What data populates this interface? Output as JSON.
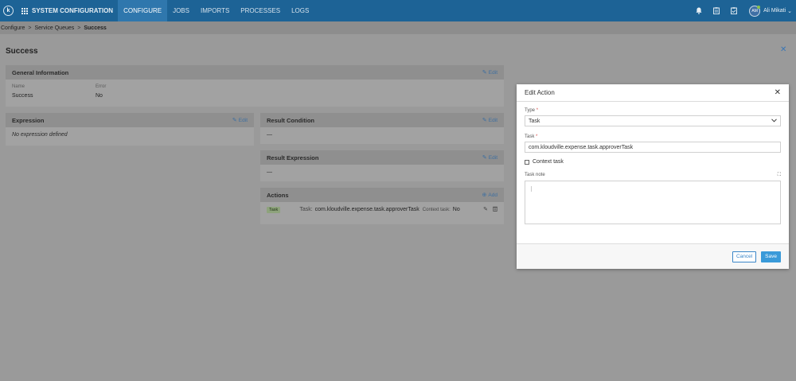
{
  "nav": {
    "logo": "k",
    "brand": "SYSTEM CONFIGURATION",
    "items": [
      "CONFIGURE",
      "JOBS",
      "IMPORTS",
      "PROCESSES",
      "LOGS"
    ],
    "active": "CONFIGURE",
    "icons": [
      "bell-icon",
      "clipboard-icon",
      "checklist-icon"
    ],
    "user": {
      "initials": "AM",
      "name": "Ali Mikati"
    }
  },
  "breadcrumb": {
    "items": [
      "Configure",
      "Service Queues",
      "Success"
    ]
  },
  "page": {
    "title": "Success"
  },
  "general": {
    "title": "General Information",
    "edit": "Edit",
    "name_label": "Name",
    "name_value": "Success",
    "error_label": "Error",
    "error_value": "No"
  },
  "expression": {
    "title": "Expression",
    "edit": "Edit",
    "body": "No expression defined"
  },
  "result_condition": {
    "title": "Result Condition",
    "edit": "Edit",
    "body": "—"
  },
  "result_expression": {
    "title": "Result Expression",
    "edit": "Edit",
    "body": "—"
  },
  "actions": {
    "title": "Actions",
    "add": "Add",
    "row": {
      "tag": "Task",
      "task_label": "Task:",
      "task_value": "com.kloudville.expense.task.approverTask",
      "context_label": "Context task:",
      "context_value": "No"
    }
  },
  "modal": {
    "title": "Edit Action",
    "type_label": "Type",
    "type_value": "Task",
    "task_label": "Task",
    "task_value": "com.kloudville.expense.task.approverTask",
    "context_label": "Context task",
    "note_label": "Task note",
    "note_value": "",
    "cancel": "Cancel",
    "save": "Save"
  },
  "colors": {
    "navbar": "#1d6396",
    "accent": "#3a9ad9",
    "required": "#d9534f"
  }
}
